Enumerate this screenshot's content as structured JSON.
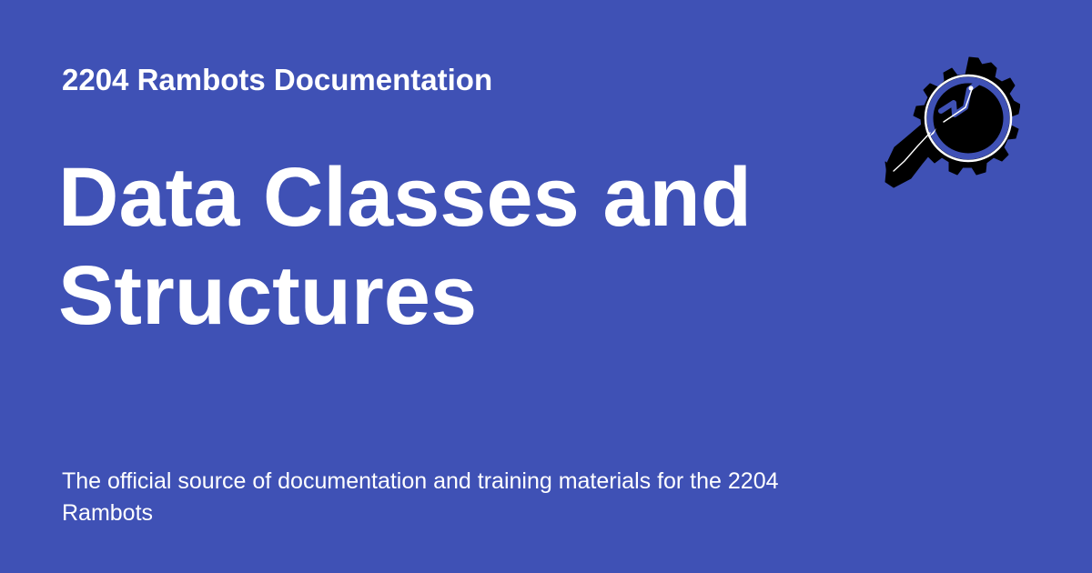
{
  "site": {
    "name": "2204 Rambots Documentation"
  },
  "page": {
    "title": "Data Classes and Structures",
    "description": "The official source of documentation and training materials for the 2204 Rambots"
  },
  "logo": {
    "icon": "gear-wrench-logo-icon"
  },
  "colors": {
    "background": "#3f51b5",
    "text": "#ffffff",
    "logo_main": "#000000",
    "logo_accent": "#3f51b5"
  }
}
